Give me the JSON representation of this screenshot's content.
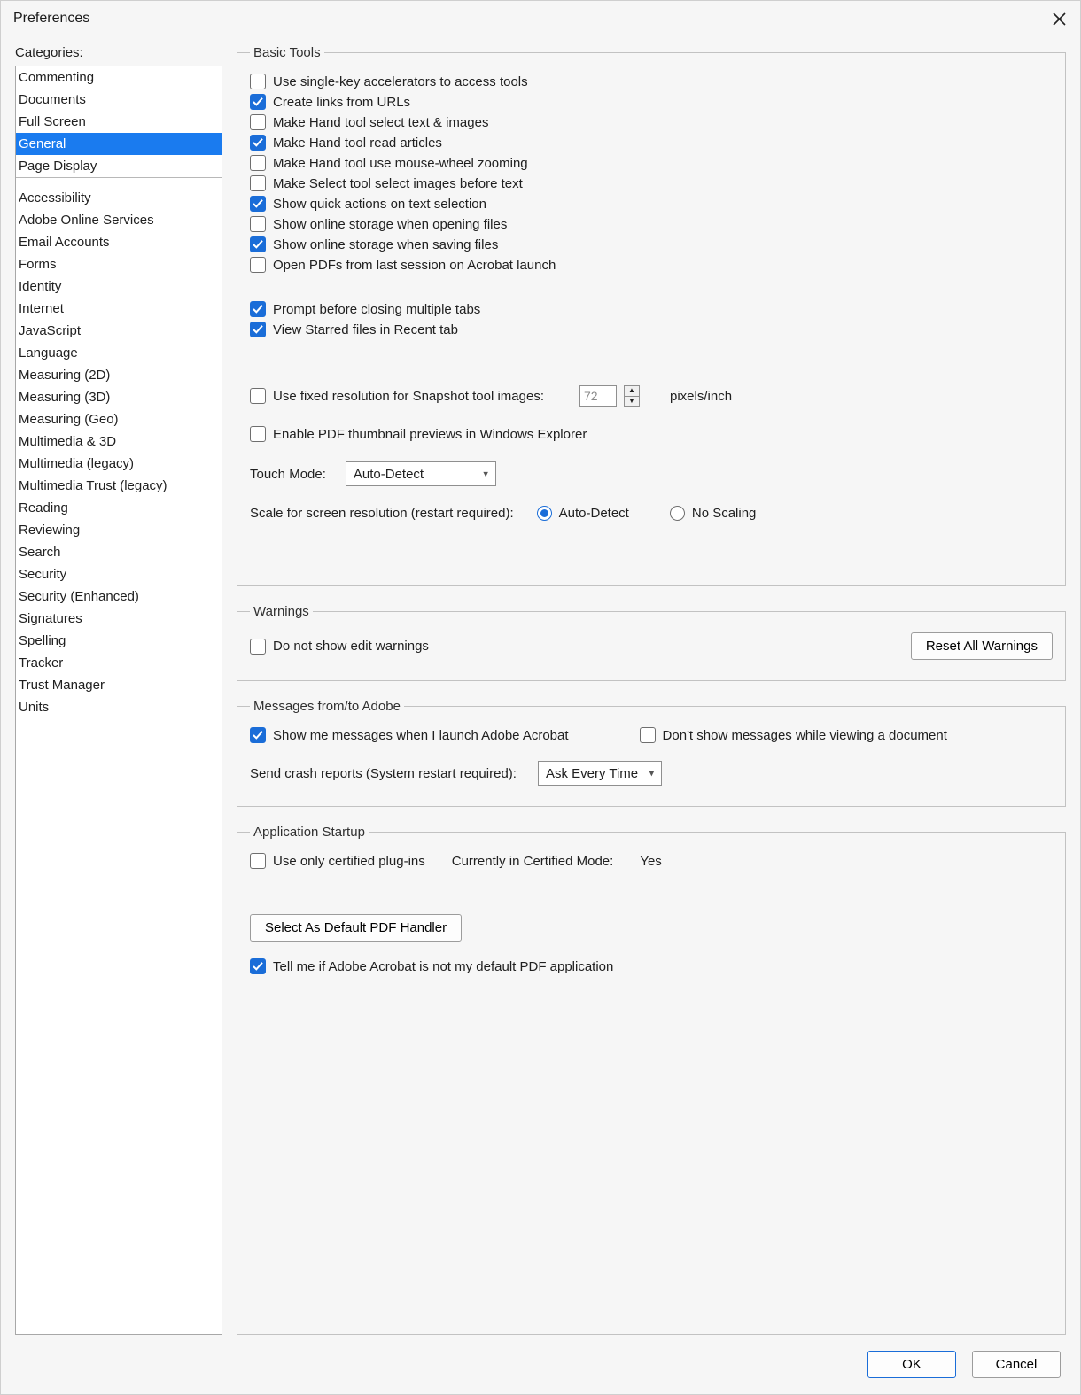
{
  "window": {
    "title": "Preferences"
  },
  "sidebar": {
    "heading": "Categories:",
    "group1": [
      "Commenting",
      "Documents",
      "Full Screen",
      "General",
      "Page Display"
    ],
    "selected": "General",
    "group2": [
      "Accessibility",
      "Adobe Online Services",
      "Email Accounts",
      "Forms",
      "Identity",
      "Internet",
      "JavaScript",
      "Language",
      "Measuring (2D)",
      "Measuring (3D)",
      "Measuring (Geo)",
      "Multimedia & 3D",
      "Multimedia (legacy)",
      "Multimedia Trust (legacy)",
      "Reading",
      "Reviewing",
      "Search",
      "Security",
      "Security (Enhanced)",
      "Signatures",
      "Spelling",
      "Tracker",
      "Trust Manager",
      "Units"
    ]
  },
  "basic_tools": {
    "legend": "Basic Tools",
    "items": [
      {
        "label": "Use single-key accelerators to access tools",
        "checked": false
      },
      {
        "label": "Create links from URLs",
        "checked": true
      },
      {
        "label": "Make Hand tool select text & images",
        "checked": false
      },
      {
        "label": "Make Hand tool read articles",
        "checked": true
      },
      {
        "label": "Make Hand tool use mouse-wheel zooming",
        "checked": false
      },
      {
        "label": "Make Select tool select images before text",
        "checked": false
      },
      {
        "label": "Show quick actions on text selection",
        "checked": true
      },
      {
        "label": "Show online storage when opening files",
        "checked": false
      },
      {
        "label": "Show online storage when saving files",
        "checked": true
      },
      {
        "label": "Open PDFs from last session on Acrobat launch",
        "checked": false
      }
    ],
    "items2": [
      {
        "label": "Prompt before closing multiple tabs",
        "checked": true
      },
      {
        "label": "View Starred files in Recent tab",
        "checked": true
      }
    ],
    "snapshot": {
      "label": "Use fixed resolution for Snapshot tool images:",
      "checked": false,
      "value": "72",
      "unit": "pixels/inch"
    },
    "thumb": {
      "label": "Enable PDF thumbnail previews in Windows Explorer",
      "checked": false
    },
    "touch_label": "Touch Mode:",
    "touch_value": "Auto-Detect",
    "scale_label": "Scale for screen resolution (restart required):",
    "scale_opts": [
      {
        "label": "Auto-Detect",
        "checked": true
      },
      {
        "label": "No Scaling",
        "checked": false
      }
    ]
  },
  "warnings": {
    "legend": "Warnings",
    "item": {
      "label": "Do not show edit warnings",
      "checked": false
    },
    "reset_btn": "Reset All Warnings"
  },
  "messages": {
    "legend": "Messages from/to Adobe",
    "show": {
      "label": "Show me messages when I launch Adobe Acrobat",
      "checked": true
    },
    "dont": {
      "label": "Don't show messages while viewing a document",
      "checked": false
    },
    "crash_label": "Send crash reports (System restart required):",
    "crash_value": "Ask Every Time"
  },
  "startup": {
    "legend": "Application Startup",
    "certified": {
      "label": "Use only certified plug-ins",
      "checked": false
    },
    "mode_label": "Currently in Certified Mode:",
    "mode_value": "Yes",
    "default_btn": "Select As Default PDF Handler",
    "tell": {
      "label": "Tell me if Adobe Acrobat is not my default PDF application",
      "checked": true
    }
  },
  "footer": {
    "ok": "OK",
    "cancel": "Cancel"
  }
}
